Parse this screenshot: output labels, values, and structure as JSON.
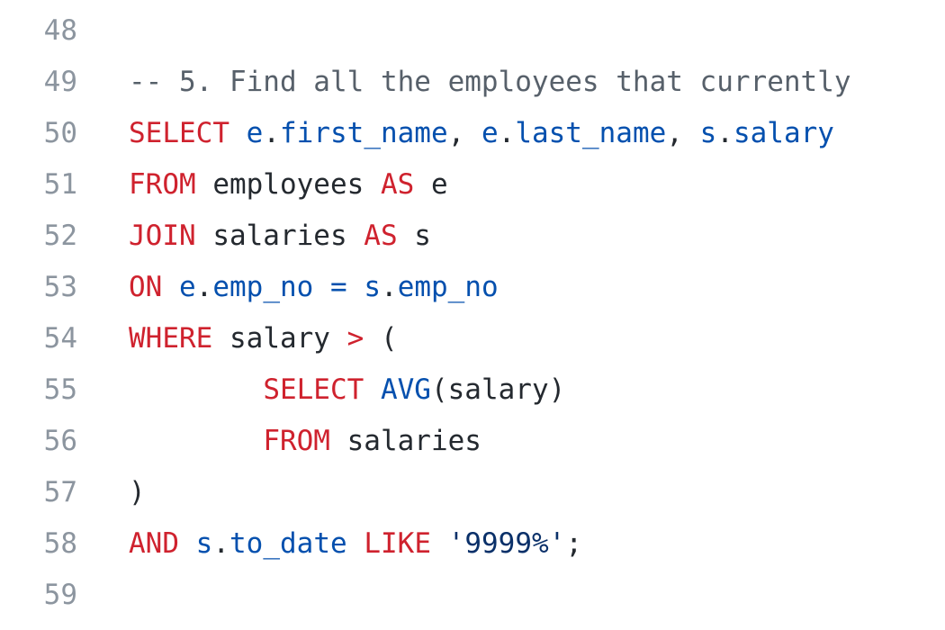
{
  "colors": {
    "background": "#ffffff",
    "line_number": "#8c959f",
    "keyword": "#cf222e",
    "function": "#0550ae",
    "string": "#0a3069",
    "comment": "#57606a",
    "plain": "#24292f"
  },
  "editor": {
    "lines": [
      {
        "number": "48",
        "tokens": []
      },
      {
        "number": "49",
        "tokens": [
          {
            "type": "comment",
            "text": "-- 5. Find all the employees that currently"
          }
        ]
      },
      {
        "number": "50",
        "tokens": [
          {
            "type": "keyword",
            "text": "SELECT"
          },
          {
            "type": "plain",
            "text": " "
          },
          {
            "type": "function",
            "text": "e"
          },
          {
            "type": "plain",
            "text": "."
          },
          {
            "type": "function",
            "text": "first_name"
          },
          {
            "type": "plain",
            "text": ", "
          },
          {
            "type": "function",
            "text": "e"
          },
          {
            "type": "plain",
            "text": "."
          },
          {
            "type": "function",
            "text": "last_name"
          },
          {
            "type": "plain",
            "text": ", "
          },
          {
            "type": "function",
            "text": "s"
          },
          {
            "type": "plain",
            "text": "."
          },
          {
            "type": "function",
            "text": "salary"
          }
        ]
      },
      {
        "number": "51",
        "tokens": [
          {
            "type": "keyword",
            "text": "FROM"
          },
          {
            "type": "plain",
            "text": " employees "
          },
          {
            "type": "keyword",
            "text": "AS"
          },
          {
            "type": "plain",
            "text": " e"
          }
        ]
      },
      {
        "number": "52",
        "tokens": [
          {
            "type": "keyword",
            "text": "JOIN"
          },
          {
            "type": "plain",
            "text": " salaries "
          },
          {
            "type": "keyword",
            "text": "AS"
          },
          {
            "type": "plain",
            "text": " s"
          }
        ]
      },
      {
        "number": "53",
        "tokens": [
          {
            "type": "keyword",
            "text": "ON"
          },
          {
            "type": "plain",
            "text": " "
          },
          {
            "type": "function",
            "text": "e"
          },
          {
            "type": "plain",
            "text": "."
          },
          {
            "type": "function",
            "text": "emp_no"
          },
          {
            "type": "plain",
            "text": " "
          },
          {
            "type": "function",
            "text": "="
          },
          {
            "type": "plain",
            "text": " "
          },
          {
            "type": "function",
            "text": "s"
          },
          {
            "type": "plain",
            "text": "."
          },
          {
            "type": "function",
            "text": "emp_no"
          }
        ]
      },
      {
        "number": "54",
        "tokens": [
          {
            "type": "keyword",
            "text": "WHERE"
          },
          {
            "type": "plain",
            "text": " salary "
          },
          {
            "type": "keyword",
            "text": ">"
          },
          {
            "type": "plain",
            "text": " ("
          }
        ]
      },
      {
        "number": "55",
        "tokens": [
          {
            "type": "plain",
            "text": "        "
          },
          {
            "type": "keyword",
            "text": "SELECT"
          },
          {
            "type": "plain",
            "text": " "
          },
          {
            "type": "function",
            "text": "AVG"
          },
          {
            "type": "plain",
            "text": "(salary)"
          }
        ]
      },
      {
        "number": "56",
        "tokens": [
          {
            "type": "plain",
            "text": "        "
          },
          {
            "type": "keyword",
            "text": "FROM"
          },
          {
            "type": "plain",
            "text": " salaries"
          }
        ]
      },
      {
        "number": "57",
        "tokens": [
          {
            "type": "plain",
            "text": ")"
          }
        ]
      },
      {
        "number": "58",
        "tokens": [
          {
            "type": "keyword",
            "text": "AND"
          },
          {
            "type": "plain",
            "text": " "
          },
          {
            "type": "function",
            "text": "s"
          },
          {
            "type": "plain",
            "text": "."
          },
          {
            "type": "function",
            "text": "to_date"
          },
          {
            "type": "plain",
            "text": " "
          },
          {
            "type": "keyword",
            "text": "LIKE"
          },
          {
            "type": "plain",
            "text": " "
          },
          {
            "type": "string",
            "text": "'9999%'"
          },
          {
            "type": "plain",
            "text": ";"
          }
        ]
      },
      {
        "number": "59",
        "tokens": []
      }
    ]
  }
}
